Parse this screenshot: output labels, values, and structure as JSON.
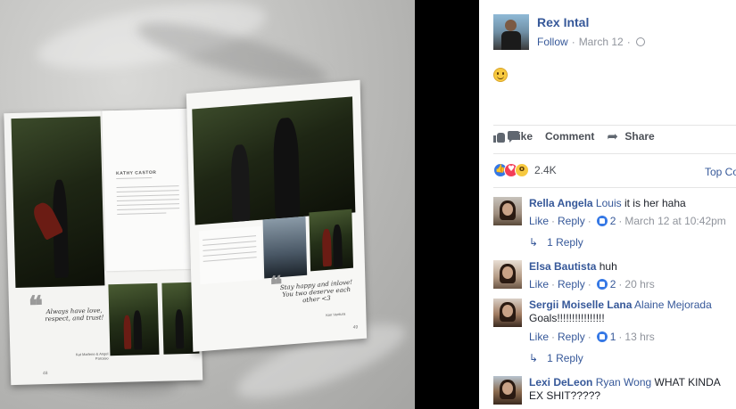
{
  "post": {
    "author": "Rex Intal",
    "follow_label": "Follow",
    "separator": "·",
    "date": "March 12",
    "body_emoji": "smile-emoji",
    "photo": {
      "card_name": "KATHY CASTOR",
      "quote_left": "Always have love, respect, and trust!",
      "quote_left_credit": "Kat Marlene & Angel Parcaso",
      "quote_right": "Stay happy and inlove! You two deserve each other <3",
      "quote_right_credit": "Kim Ventura",
      "page_left": "48",
      "page_right": "49"
    }
  },
  "actions": {
    "like": "Like",
    "comment": "Comment",
    "share": "Share"
  },
  "reactions": {
    "count": "2.4K",
    "types": [
      "like",
      "love",
      "wow"
    ],
    "top_comments_label": "Top Co"
  },
  "comments": [
    {
      "name": "Rella Angela",
      "tag": "Louis",
      "text": "it is her haha",
      "like_label": "Like",
      "reply_label": "Reply",
      "likes": "2",
      "time": "March 12 at 10:42pm",
      "replies_label": "1 Reply"
    },
    {
      "name": "Elsa Bautista",
      "tag": "",
      "text": "huh",
      "like_label": "Like",
      "reply_label": "Reply",
      "likes": "2",
      "time": "20 hrs",
      "replies_label": ""
    },
    {
      "name": "Sergii Moiselle Lana",
      "tag": "Alaine Mejorada",
      "text": "Goals!!!!!!!!!!!!!!!!",
      "like_label": "Like",
      "reply_label": "Reply",
      "likes": "1",
      "time": "13 hrs",
      "replies_label": "1 Reply"
    },
    {
      "name": "Lexi DeLeon",
      "tag": "Ryan Wong",
      "text": "WHAT KINDA EX SHIT?????",
      "like_label": "",
      "reply_label": "",
      "likes": "",
      "time": "",
      "replies_label": ""
    }
  ],
  "colors": {
    "link": "#365899",
    "meta": "#90949c",
    "like_blue": "#3578e5",
    "love_red": "#f33e58"
  }
}
